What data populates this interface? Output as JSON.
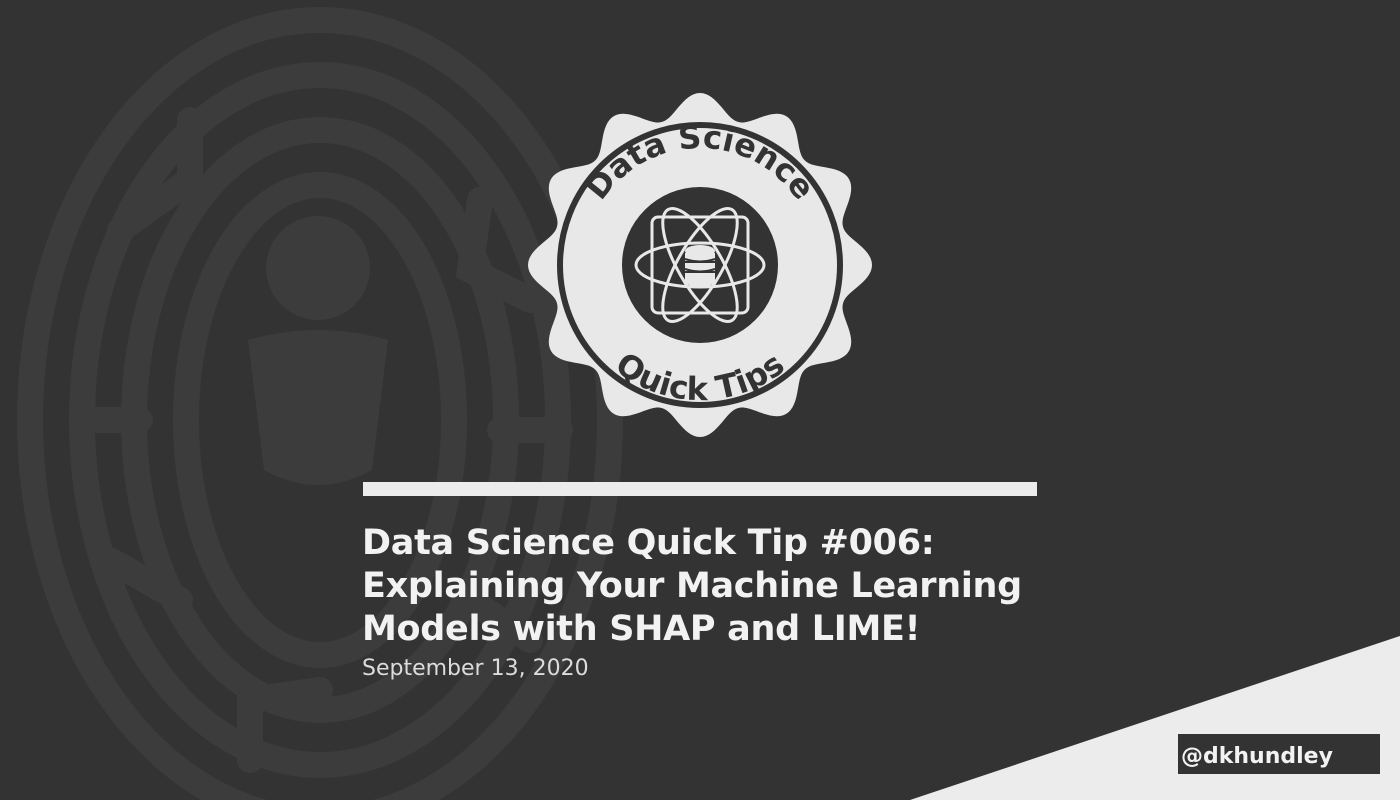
{
  "badge": {
    "top_text": "Data Science",
    "bottom_text": "Quick Tips",
    "icon": "atom-database-icon"
  },
  "background": {
    "icon": "maze-person-icon",
    "color": "#333333",
    "accent": "#ececec"
  },
  "post": {
    "title_lines": [
      "Data Science Quick Tip #006:",
      "Explaining Your Machine Learning",
      "Models with SHAP and LIME!"
    ],
    "date": "September 13, 2020"
  },
  "author": {
    "handle": "@dkhundley"
  }
}
